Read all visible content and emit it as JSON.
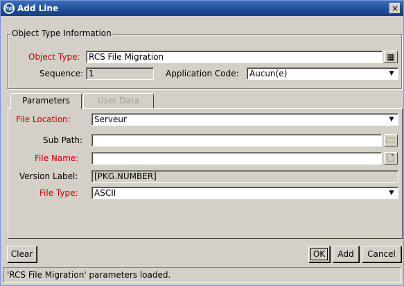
{
  "window": {
    "title": "Add Line",
    "close_label": "×",
    "logo_text": "hp"
  },
  "object_type_info": {
    "legend": "Object Type Information",
    "object_type_label": "Object Type:",
    "object_type_value": "RCS File Migration",
    "sequence_label": "Sequence:",
    "sequence_value": "1",
    "application_code_label": "Application Code:",
    "application_code_value": "Aucun(e)"
  },
  "tabs": [
    {
      "label": "Parameters",
      "state": "active"
    },
    {
      "label": "User Data",
      "state": "disabled"
    }
  ],
  "parameters": {
    "file_location_label": "File Location:",
    "file_location_value": "Serveur",
    "sub_path_label": "Sub Path:",
    "sub_path_value": "",
    "file_name_label": "File Name:",
    "file_name_value": "",
    "version_label_label": "Version Label:",
    "version_label_value": "[PKG.NUMBER]",
    "file_type_label": "File Type:",
    "file_type_value": "ASCII"
  },
  "buttons": {
    "clear": "Clear",
    "ok": "OK",
    "add": "Add",
    "cancel": "Cancel"
  },
  "status": {
    "message": "'RCS File Migration' parameters loaded."
  },
  "colors": {
    "required_label": "#c00000",
    "titlebar": "#1f4f98",
    "background": "#d4d0c8"
  },
  "icons": {
    "object_type_browse": "list-icon",
    "sub_path_browse": "folder-open-icon",
    "file_name_browse": "file-icon",
    "dropdown": "chevron-down-icon"
  }
}
